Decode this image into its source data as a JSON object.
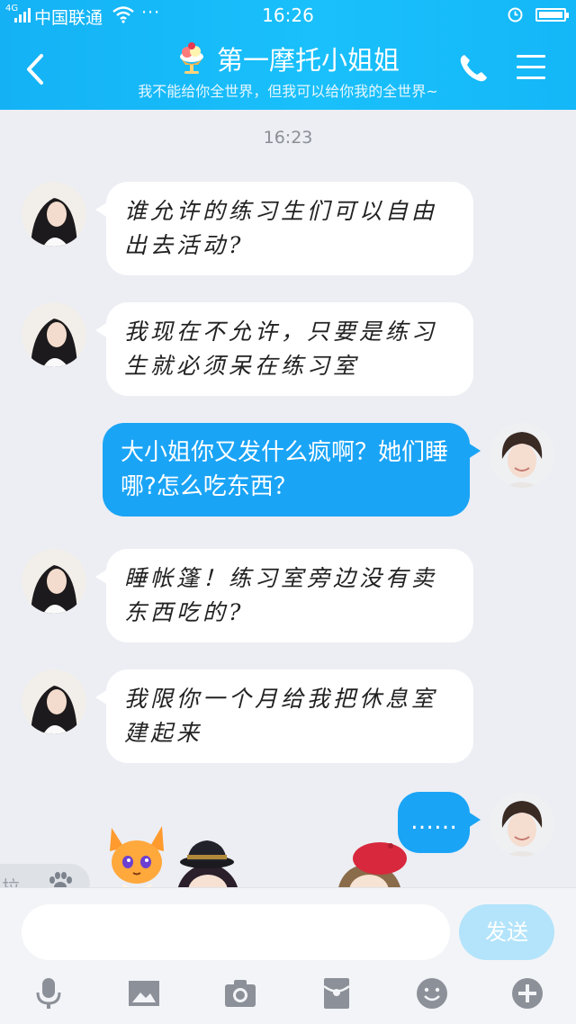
{
  "status_bar": {
    "network": "4G",
    "carrier": "中国联通",
    "more": "···",
    "time": "16:26"
  },
  "header": {
    "title": "第一摩托小姐姐",
    "subtitle": "我不能给你全世界，但我可以给你我的全世界~"
  },
  "chat": {
    "timestamp": "16:23",
    "messages": [
      {
        "from": "other",
        "text": "谁允许的练习生们可以自由出去活动?"
      },
      {
        "from": "other",
        "text": "我现在不允许，只要是练习生就必须呆在练习室"
      },
      {
        "from": "me",
        "text": "大小姐你又发什么疯啊？她们睡哪?怎么吃东西？"
      },
      {
        "from": "other",
        "text": "睡帐篷！练习室旁边没有卖东西吃的?"
      },
      {
        "from": "other",
        "text": "我限你一个月给我把休息室建起来"
      },
      {
        "from": "me",
        "text": "……"
      }
    ]
  },
  "pull_tab": {
    "label": "拉"
  },
  "input": {
    "placeholder": "",
    "value": "",
    "send_label": "发送"
  },
  "colors": {
    "header": "#19b9f8",
    "outgoing_bubble": "#1aa4f6",
    "incoming_bubble": "#ffffff",
    "background": "#eceef3",
    "send_button": "#b3e4fb",
    "toolbar_icon": "#8c9099"
  },
  "icons": {
    "back": "chevron-left-icon",
    "call": "phone-icon",
    "menu": "hamburger-menu-icon",
    "toolbar": [
      "microphone-icon",
      "image-icon",
      "camera-icon",
      "red-packet-icon",
      "emoji-icon",
      "plus-icon"
    ]
  }
}
